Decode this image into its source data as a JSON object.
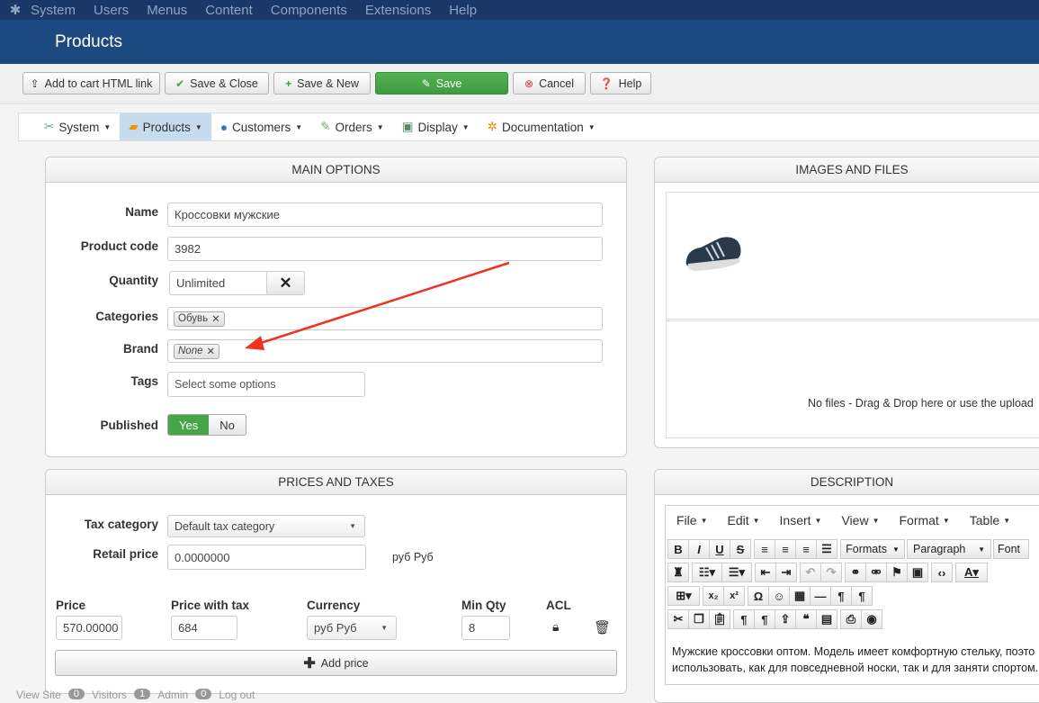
{
  "topnav": [
    "System",
    "Users",
    "Menus",
    "Content",
    "Components",
    "Extensions",
    "Help"
  ],
  "header": {
    "title": "Products"
  },
  "toolbar": {
    "add_cart": "Add to cart HTML link",
    "save_close": "Save & Close",
    "save_new": "Save & New",
    "save": "Save",
    "cancel": "Cancel",
    "help": "Help"
  },
  "menu": [
    "System",
    "Products",
    "Customers",
    "Orders",
    "Display",
    "Documentation"
  ],
  "main_options": {
    "title": "MAIN OPTIONS",
    "name_label": "Name",
    "name_value": "Кроссовки мужские",
    "code_label": "Product code",
    "code_value": "3982",
    "qty_label": "Quantity",
    "qty_value": "Unlimited",
    "cat_label": "Categories",
    "cat_tag": "Обувь",
    "brand_label": "Brand",
    "brand_tag": "None",
    "tags_label": "Tags",
    "tags_placeholder": "Select some options",
    "pub_label": "Published",
    "pub_yes": "Yes",
    "pub_no": "No"
  },
  "images": {
    "title": "IMAGES AND FILES",
    "dropzone": "No files - Drag & Drop here or use the upload"
  },
  "prices": {
    "title": "PRICES AND TAXES",
    "tax_label": "Tax category",
    "tax_value": "Default tax category",
    "retail_label": "Retail price",
    "retail_value": "0.0000000",
    "retail_unit": "руб Руб",
    "col_price": "Price",
    "col_tax": "Price with tax",
    "col_currency": "Currency",
    "col_minqty": "Min Qty",
    "col_acl": "ACL",
    "price": "570.00000",
    "price_tax": "684",
    "currency": "руб Руб",
    "minqty": "8",
    "add_price": "Add price"
  },
  "description": {
    "title": "DESCRIPTION",
    "menus": [
      "File",
      "Edit",
      "Insert",
      "View",
      "Format",
      "Table"
    ],
    "formats": "Formats",
    "paragraph": "Paragraph",
    "font": "Font",
    "text": "Мужские кроссовки оптом. Модель имеет комфортную стельку, поэто использовать, как для повседневной носки, так и для заняти спортом."
  },
  "footer": {
    "view_site": "View Site",
    "visitors_n": "0",
    "visitors": "Visitors",
    "admin_n": "1",
    "admin": "Admin",
    "msg_n": "0",
    "logout": "Log out"
  }
}
